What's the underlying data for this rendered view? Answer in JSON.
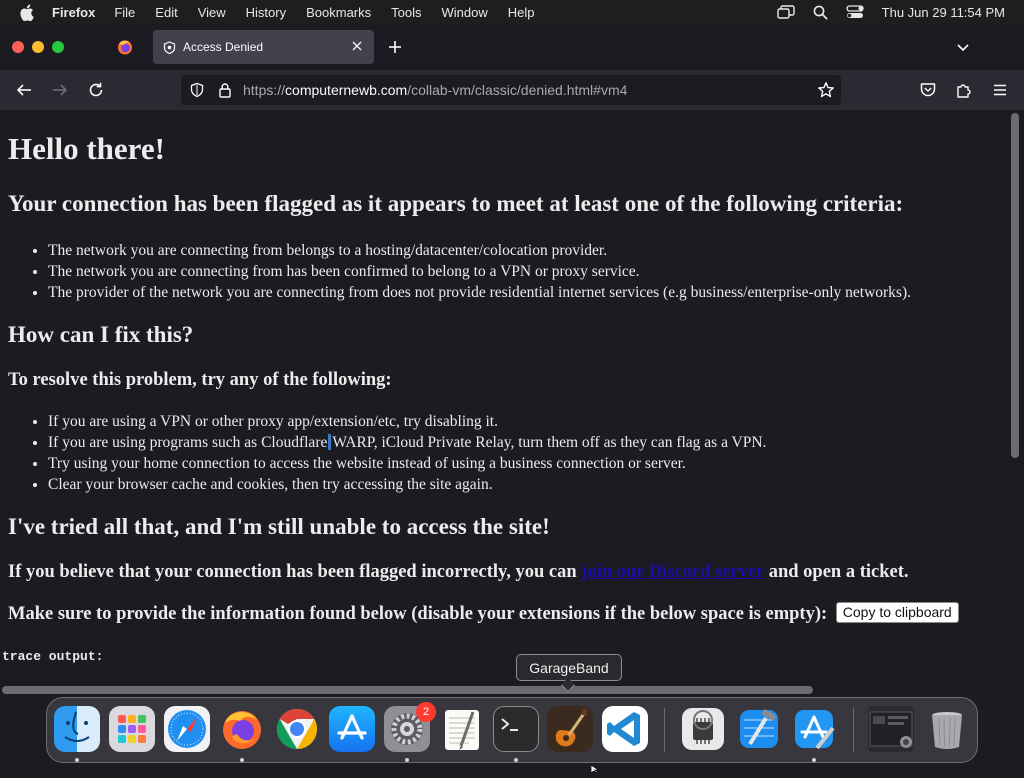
{
  "menubar": {
    "app": "Firefox",
    "items": [
      "File",
      "Edit",
      "View",
      "History",
      "Bookmarks",
      "Tools",
      "Window",
      "Help"
    ],
    "clock": "Thu Jun 29  11:54 PM"
  },
  "tab": {
    "title": "Access Denied"
  },
  "url": {
    "prefix": "https://",
    "host": "computernewb.com",
    "path": "/collab-vm/classic/denied.html#vm4"
  },
  "page": {
    "h1": "Hello there!",
    "criteria_heading": "Your connection has been flagged as it appears to meet at least one of the following criteria:",
    "criteria": [
      "The network you are connecting from belongs to a hosting/datacenter/colocation provider.",
      "The network you are connecting from has been confirmed to belong to a VPN or proxy service.",
      "The provider of the network you are connecting from does not provide residential internet services (e.g business/enterprise-only networks)."
    ],
    "fix_heading": "How can I fix this?",
    "resolve_heading": "To resolve this problem, try any of the following:",
    "fixes": [
      "If you are using a VPN or other proxy app/extension/etc, try disabling it.",
      "If you are using programs such as Cloudflare",
      "WARP, iCloud Private Relay, turn them off as they can flag as a VPN.",
      "Try using your home connection to access the website instead of using a business connection or server.",
      "Clear your browser cache and cookies, then try accessing the site again."
    ],
    "tried_heading": "I've tried all that, and I'm still unable to access the site!",
    "incorrect_before": "If you believe that your connection has been flagged incorrectly, you can ",
    "discord_link": "join our Discord server",
    "incorrect_after": " and open a ticket.",
    "info_text": "Make sure to provide the information found below (disable your extensions if the below space is empty):",
    "copy_button": "Copy to clipboard",
    "trace_label": "trace output:"
  },
  "dock": {
    "tooltip": "GarageBand",
    "settings_badge": "2",
    "apps": [
      "Finder",
      "Launchpad",
      "Safari",
      "Firefox",
      "Chrome",
      "App Store",
      "System Settings",
      "TextEdit",
      "Terminal",
      "GarageBand",
      "Visual Studio Code",
      "System Information",
      "Xcode",
      "Simulator",
      "Mission Control",
      "Trash"
    ]
  }
}
